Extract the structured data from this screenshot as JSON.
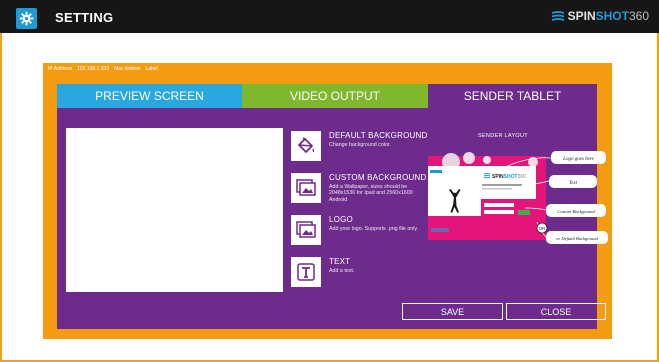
{
  "header": {
    "title": "SETTING",
    "brand": {
      "part1": "SPIN",
      "part2": "SHOT",
      "part3": "360"
    }
  },
  "info": {
    "ip_label": "IP Address",
    "ip_value": "192.168.1.333",
    "mac_label": "Mac Addres",
    "mac_value": "Label"
  },
  "tabs": [
    {
      "label": "PREVIEW SCREEN"
    },
    {
      "label": "VIDEO OUTPUT"
    },
    {
      "label": "SENDER TABLET"
    }
  ],
  "options": [
    {
      "title": "DEFAULT BACKGROUND",
      "desc": "Change background color."
    },
    {
      "title": "CUSTOM BACKGROUND",
      "desc": "Add a Wallpaper, sizes should be 2048x1536 for Ipad and 2560x1600 Android"
    },
    {
      "title": "LOGO",
      "desc": "Add your logo. Supports .png file only."
    },
    {
      "title": "TEXT",
      "desc": "Add a text."
    }
  ],
  "layout": {
    "title": "SENDER LAYOUT",
    "callouts": {
      "logo": "Logo goes here",
      "text": "Text",
      "custom": "Custom Background",
      "default": "or Default Background",
      "or": "OR"
    }
  },
  "buttons": {
    "save": "SAVE",
    "close": "CLOSE"
  },
  "colors": {
    "orange": "#f39c12",
    "purple": "#6d2b8c",
    "blue": "#29a8df",
    "green": "#7fb82e"
  }
}
